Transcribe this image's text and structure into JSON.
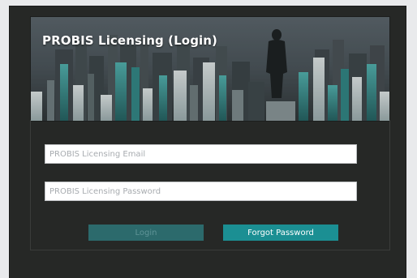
{
  "window": {
    "title": "PROBIS Licensing (Login)"
  },
  "form": {
    "email": {
      "value": "",
      "placeholder": "PROBIS Licensing Email"
    },
    "password": {
      "value": "",
      "placeholder": "PROBIS Licensing Password"
    },
    "login_label": "Login",
    "forgot_label": "Forgot Password"
  },
  "colors": {
    "window_bg": "#262826",
    "accent": "#1b8f93",
    "accent_disabled": "#2c6a6c"
  }
}
